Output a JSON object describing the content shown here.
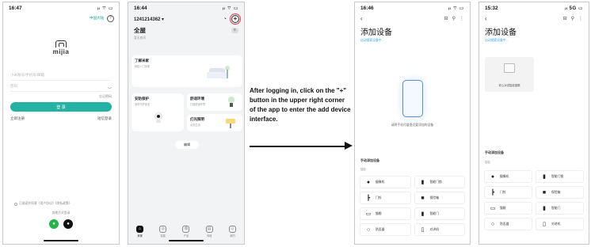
{
  "phone1": {
    "time": "16:47",
    "status_icons": "ᵢₗ ⌔ ▭",
    "region": "中国大陆",
    "help_icon": "?",
    "logo_text": "mijia",
    "account_placeholder": "小米账号/手机号/邮箱",
    "password_placeholder": "密码",
    "eye_icon": "‿",
    "forgot": "忘记密码",
    "login": "登 录",
    "register": "立即注册",
    "sms_login": "短信登录",
    "agreement": "已阅读并同意《用户协议》《隐私政策》",
    "other_methods": "其他方式登录"
  },
  "phone2": {
    "time": "16:44",
    "status_icons": "ᵢₗ ⌔ ▭",
    "account": "12412143​62 ▾",
    "plus_icon": "+",
    "home_title": "全屋",
    "menu_icon": "≡",
    "room_sub": "暂无房间",
    "cards": [
      {
        "title": "了解米家",
        "sub": "轻松入门米家"
      },
      {
        "title": "安防保护",
        "sub": "全时守护安全"
      },
      {
        "title": "舒适环境",
        "sub": "打造舒适环境"
      },
      {
        "title": "灯光照明",
        "sub": "点亮生活"
      }
    ],
    "edit": "编辑",
    "tabs": [
      "米家",
      "智能",
      "产品",
      "商城",
      "我的"
    ]
  },
  "instruction": "After logging in, click on the \"+\" button in the upper right corner of the app to enter the add device interface.",
  "phone3": {
    "time": "16:46",
    "status_icons": "ᵢₗ ⌔ ▭",
    "back_icon": "‹",
    "scan_icon": "⊟",
    "search_icon": "⚲",
    "more_icon": "⋮",
    "title": "添加设备",
    "subtitle": "自动搜索设备中...",
    "searching": "请将手机尽量靠近要添加的设备",
    "manual_title": "手动添加设备",
    "category": "智能",
    "devices": [
      "摄像机",
      "智能门锁",
      "门铃",
      "保险箱",
      "猫眼",
      "智能门",
      "防丢器",
      "对讲机"
    ]
  },
  "phone4": {
    "time": "15:32",
    "status_icons": "ᵢₗ 5G ▭",
    "back_icon": "‹",
    "scan_icon": "⊟",
    "search_icon": "⚲",
    "more_icon": "⋮",
    "title": "添加设备",
    "subtitle": "自动搜索设备中...",
    "found_device": "安心对讲智能猫眼",
    "manual_title": "手动添加设备",
    "category": "智能",
    "devices": [
      "摄像机",
      "智能门锁",
      "门铃",
      "保险箱",
      "猫眼",
      "智能门",
      "防丢器",
      "对讲机"
    ]
  }
}
